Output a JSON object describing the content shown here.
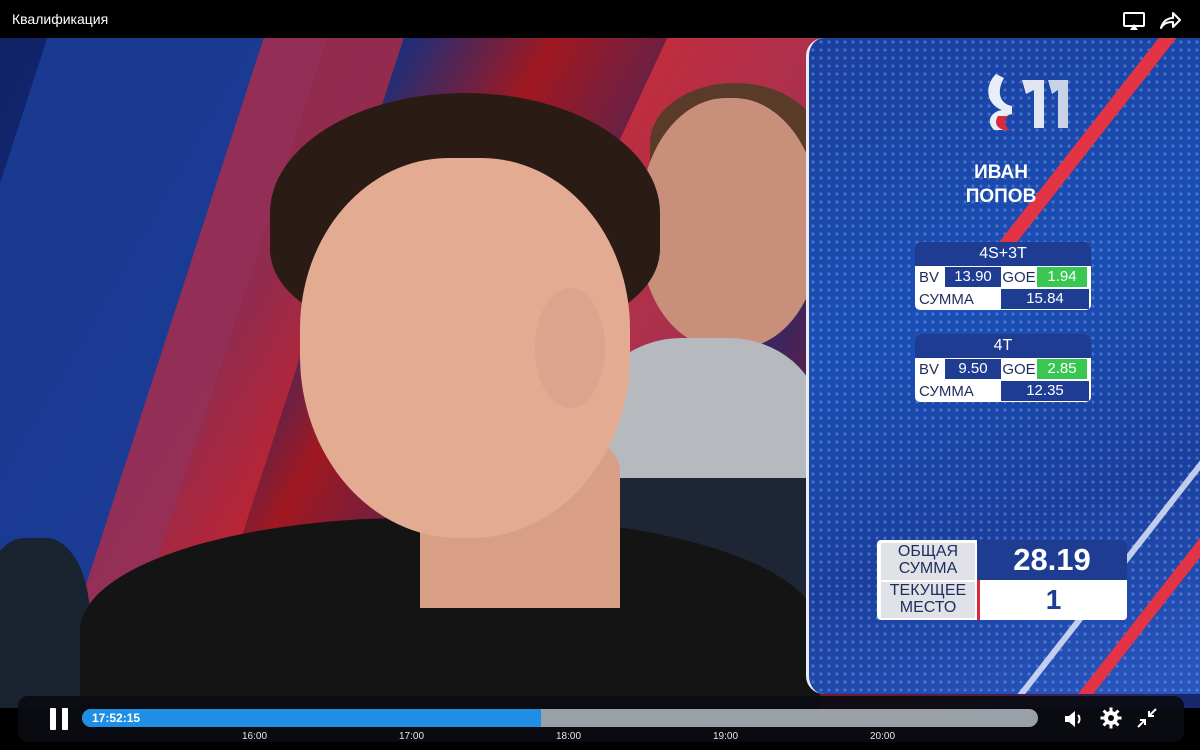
{
  "window": {
    "title": "Квалификация"
  },
  "toolbar": {
    "cast_icon": "cast-icon",
    "share_icon": "share-icon"
  },
  "video": {
    "channel_logo": "channel-one-logo",
    "athlete": {
      "first_name": "ИВАН",
      "last_name": "ПОПОВ"
    },
    "elements": [
      {
        "name": "4S+3T",
        "bv_label": "BV",
        "bv": "13.90",
        "goe_label": "GOE",
        "goe": "1.94",
        "sum_label": "СУММА",
        "sum": "15.84"
      },
      {
        "name": "4T",
        "bv_label": "BV",
        "bv": "9.50",
        "goe_label": "GOE",
        "goe": "2.85",
        "sum_label": "СУММА",
        "sum": "12.35"
      }
    ],
    "total": {
      "label_line1": "ОБЩАЯ",
      "label_line2": "СУММА",
      "value": "28.19"
    },
    "place": {
      "label_line1": "ТЕКУЩЕЕ",
      "label_line2": "МЕСТО",
      "value": "1"
    }
  },
  "player": {
    "current_time": "17:52:15",
    "progress": 0.48,
    "ticks": [
      "16:00",
      "17:00",
      "18:00",
      "19:00",
      "20:00"
    ],
    "icons": {
      "play_pause": "pause-icon",
      "volume": "volume-icon",
      "settings": "gear-icon",
      "fullscreen": "exit-fullscreen-icon"
    }
  },
  "colors": {
    "accent_blue": "#1d3c92",
    "goe_green": "#38c751",
    "progress_blue": "#1f8fe5",
    "brand_red": "#d82b3a"
  }
}
